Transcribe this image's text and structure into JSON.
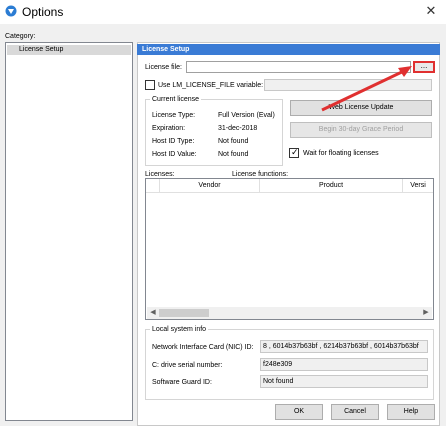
{
  "window": {
    "title": "Options",
    "close_glyph": "✕"
  },
  "category": {
    "label": "Category:",
    "items": [
      "License Setup"
    ]
  },
  "panel": {
    "header": "License Setup",
    "license_file_label": "License file:",
    "license_file_value": "",
    "browse_label": "...",
    "use_lm_label": "Use LM_LICENSE_FILE variable:",
    "use_lm_checked": false,
    "lm_value": ""
  },
  "current_license": {
    "title": "Current license",
    "rows": [
      {
        "label": "License Type:",
        "value": "Full Version (Eval)"
      },
      {
        "label": "Expiration:",
        "value": "31-dec-2018"
      },
      {
        "label": "Host ID Type:",
        "value": "Not found"
      },
      {
        "label": "Host ID Value:",
        "value": "Not found"
      }
    ]
  },
  "buttons": {
    "web_license_update": "Web License Update",
    "grace_period": "Begin 30-day Grace Period",
    "ok": "OK",
    "cancel": "Cancel",
    "help": "Help"
  },
  "floating": {
    "label": "Wait for floating licenses",
    "checked": true
  },
  "licenses": {
    "licenses_label": "Licenses:",
    "features_label": "License functions:",
    "columns": [
      "",
      "Vendor",
      "Product",
      "Versi"
    ]
  },
  "local_info": {
    "title": "Local system info",
    "rows": [
      {
        "label": "Network Interface Card (NIC) ID:",
        "value": "8 , 6014b37b63bf , 6214b37b63bf , 6014b37b63bf"
      },
      {
        "label": "C: drive serial number:",
        "value": "f248e309"
      },
      {
        "label": "Software Guard ID:",
        "value": "Not found"
      }
    ]
  },
  "colors": {
    "header_bg": "#3a7bd5",
    "highlight": "#e03030"
  }
}
